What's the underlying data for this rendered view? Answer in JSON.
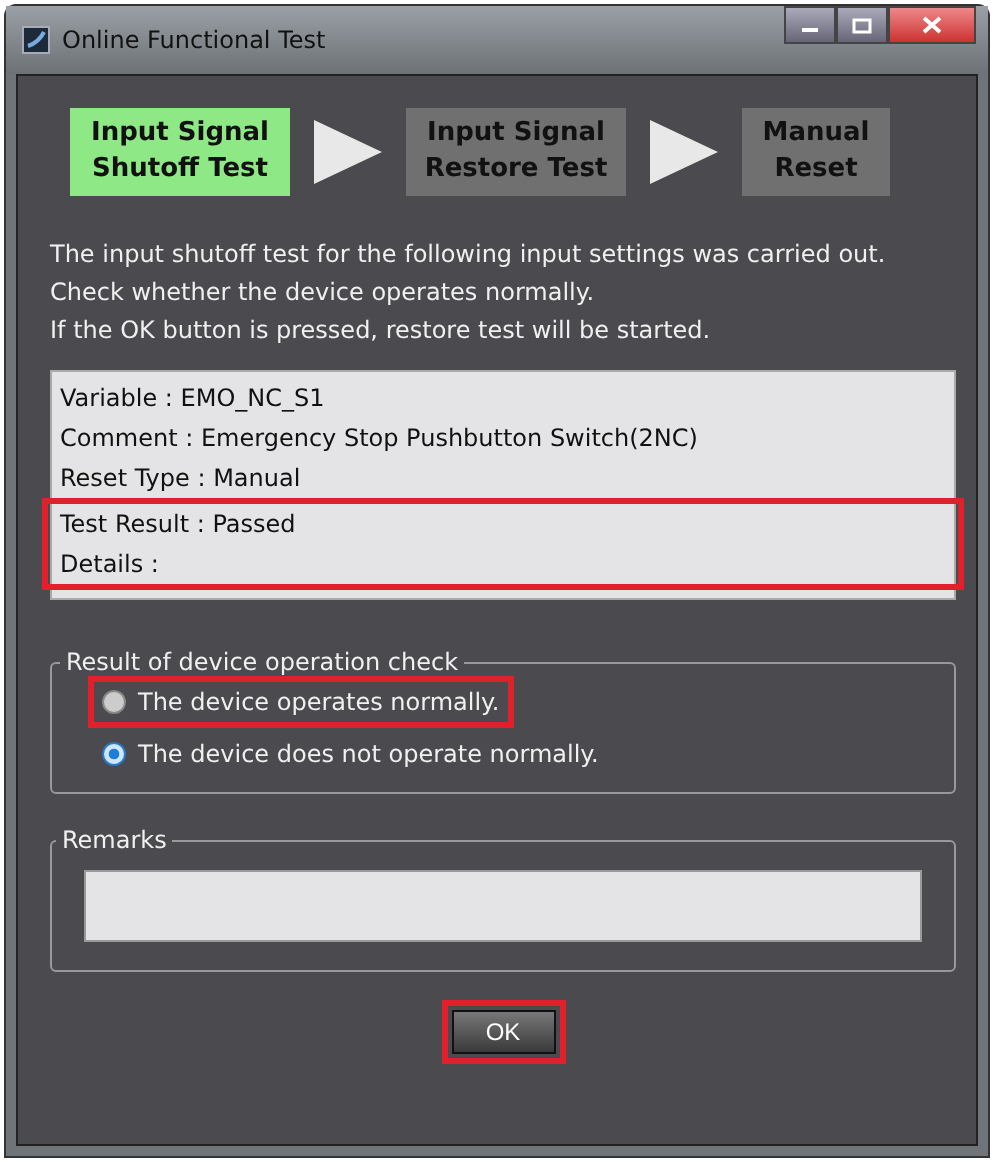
{
  "window": {
    "title": "Online Functional Test"
  },
  "steps": [
    {
      "label": "Input Signal Shutoff Test",
      "selected": true
    },
    {
      "label": "Input Signal Restore Test",
      "selected": false
    },
    {
      "label": "Manual Reset",
      "selected": false
    }
  ],
  "message": [
    "The input shutoff test for the following input settings was carried out.",
    "Check whether the device operates normally.",
    "If the OK button is pressed, restore test will be started."
  ],
  "info_lines": [
    {
      "text": "Variable : EMO_NC_S1",
      "highlighted": false
    },
    {
      "text": "Comment : Emergency Stop Pushbutton Switch(2NC)",
      "highlighted": false
    },
    {
      "text": "Reset Type : Manual",
      "highlighted": false
    },
    {
      "text": "Test Result : Passed",
      "highlighted": true
    },
    {
      "text": "Details :",
      "highlighted": true
    }
  ],
  "result_group": {
    "title": "Result of device operation check",
    "options": [
      {
        "label": "The device operates normally.",
        "selected": false,
        "highlighted": true
      },
      {
        "label": "The device does not operate normally.",
        "selected": true,
        "highlighted": false
      }
    ]
  },
  "remarks": {
    "title": "Remarks"
  },
  "ok_button": {
    "label": "OK",
    "highlighted": true
  }
}
